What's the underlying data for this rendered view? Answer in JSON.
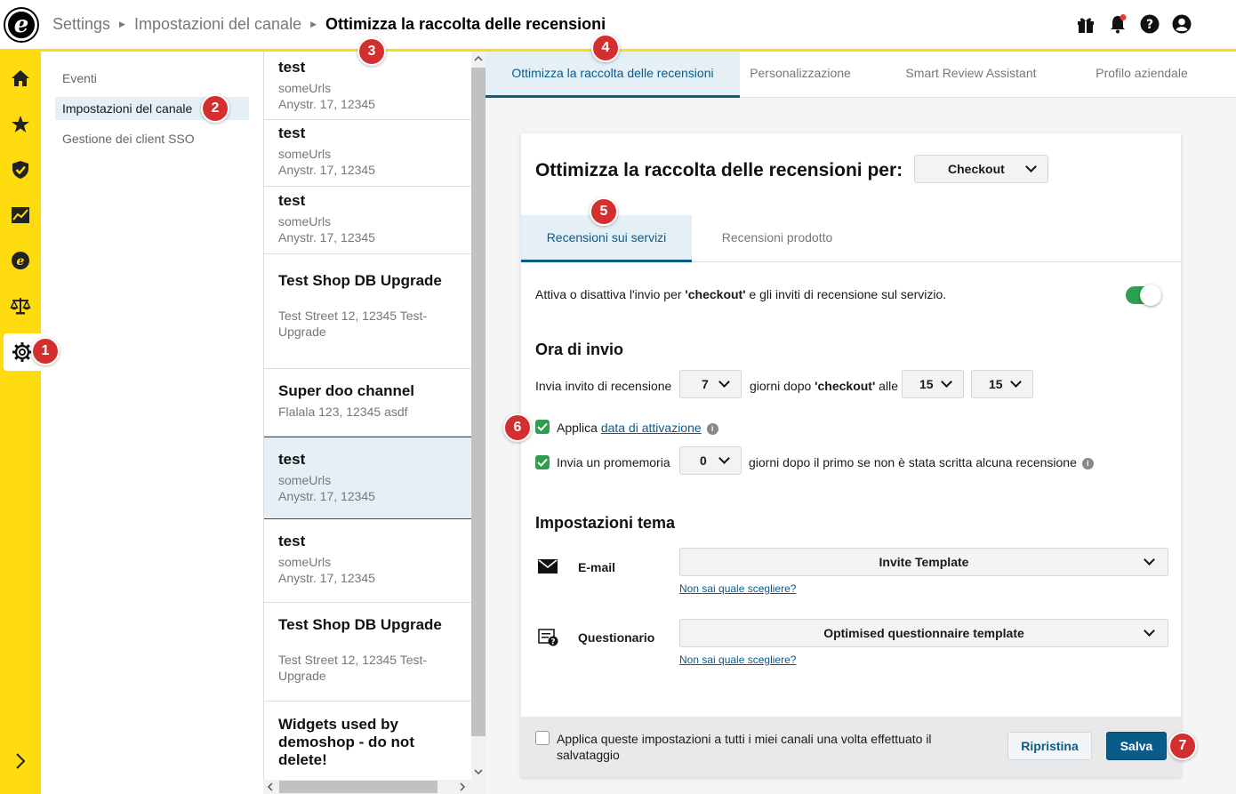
{
  "header": {
    "logo": "e",
    "breadcrumb": [
      "Settings",
      "Impostazioni del canale",
      "Ottimizza la raccolta delle recensioni"
    ]
  },
  "sidebar": {
    "icons": [
      "home-icon",
      "star-icon",
      "shield-check-icon",
      "chart-icon",
      "trusted-e-icon",
      "scales-icon",
      "gear-icon",
      "chevron-right-icon"
    ]
  },
  "subnav": {
    "items": [
      "Eventi",
      "Impostazioni del canale",
      "Gestione dei client SSO"
    ]
  },
  "channels": [
    {
      "name": "test",
      "line1": "someUrls",
      "line2": "Anystr. 17, 12345"
    },
    {
      "name": "test",
      "line1": "someUrls",
      "line2": "Anystr. 17, 12345"
    },
    {
      "name": "test",
      "line1": "someUrls",
      "line2": "Anystr. 17, 12345"
    },
    {
      "name": "Test Shop DB Upgrade",
      "line1": "Test Street 12, 12345 Test-",
      "line2": "Upgrade"
    },
    {
      "name": "Super doo channel",
      "line1": "Flalala 123, 12345 asdf",
      "line2": ""
    },
    {
      "name": "test",
      "line1": "someUrls",
      "line2": "Anystr. 17, 12345"
    },
    {
      "name": "test",
      "line1": "someUrls",
      "line2": "Anystr. 17, 12345"
    },
    {
      "name": "Test Shop DB Upgrade",
      "line1": "Test Street 12, 12345 Test-",
      "line2": "Upgrade"
    },
    {
      "name": "Widgets used by demoshop - do not delete!",
      "line1": "",
      "line2": ""
    }
  ],
  "tabs": [
    "Ottimizza la raccolta delle recensioni",
    "Personalizzazione",
    "Smart Review Assistant",
    "Profilo aziendale"
  ],
  "panel": {
    "title": "Ottimizza la raccolta delle recensioni per:",
    "event_select": "Checkout",
    "inner_tabs": [
      "Recensioni sui servizi",
      "Recensioni prodotto"
    ],
    "toggle_text_a": "Attiva o disattiva l'invio per ",
    "toggle_text_b": "'checkout'",
    "toggle_text_c": " e gli inviti di recensione sul servizio.",
    "send_time_heading": "Ora di invio",
    "invite_label": "Invia invito di recensione",
    "days_value": "7",
    "days_after_a": "giorni dopo ",
    "days_after_b": "'checkout'",
    "days_after_c": " alle",
    "hour_value": "15",
    "minute_value": "15",
    "apply_label": "Applica ",
    "activation_link": "data di attivazione",
    "reminder_label": "Invia un promemoria",
    "reminder_days": "0",
    "reminder_text": "giorni dopo il primo se non è stata scritta alcuna recensione",
    "theme_heading": "Impostazioni tema",
    "email_label": "E-mail",
    "email_template": "Invite Template",
    "help_link": "Non sai quale scegliere?",
    "questionnaire_label": "Questionario",
    "questionnaire_template": "Optimised questionnaire template",
    "footer_text_1": "Applica queste impostazioni a tutti i miei canali una volta effettuato il",
    "footer_text_2": "salvataggio",
    "reset_label": "Ripristina",
    "save_label": "Salva"
  },
  "badges": [
    "1",
    "2",
    "3",
    "4",
    "5",
    "6",
    "7"
  ],
  "colors": {
    "accent": "#FFDC0F",
    "primary": "#0a5a8a",
    "success": "#2e9e4f",
    "badge": "#d32f2f"
  }
}
